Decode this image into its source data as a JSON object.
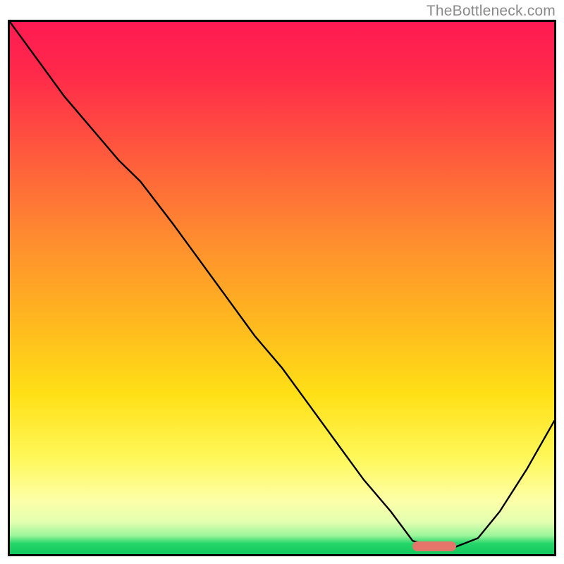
{
  "watermark": "TheBottleneck.com",
  "colors": {
    "gradient_top": "#ff1a52",
    "gradient_bottom": "#12c85e",
    "curve": "#000000",
    "marker": "#e5746b",
    "border": "#000000",
    "watermark": "#8a8a8a"
  },
  "chart_data": {
    "type": "line",
    "title": "",
    "xlabel": "",
    "ylabel": "",
    "xlim": [
      0,
      100
    ],
    "ylim": [
      0,
      100
    ],
    "grid": false,
    "legend": false,
    "background": "vertical red→yellow→green gradient (green at bottom)",
    "series": [
      {
        "name": "curve",
        "color": "#000000",
        "comment": "y is a distance/mismatch metric; 0 at bottom, 100 at top. Values estimated from pixel positions.",
        "x": [
          0,
          5,
          10,
          15,
          20,
          24,
          30,
          35,
          40,
          45,
          50,
          55,
          60,
          65,
          70,
          74,
          78,
          82,
          86,
          90,
          95,
          100
        ],
        "y": [
          100,
          93,
          86,
          80,
          74,
          70,
          62,
          55,
          48,
          41,
          35,
          28,
          21,
          14,
          8,
          2.5,
          1.4,
          1.4,
          3,
          8,
          16,
          25
        ]
      }
    ],
    "annotations": [
      {
        "name": "marker",
        "shape": "rounded-bar",
        "color": "#e5746b",
        "x_range": [
          74,
          82
        ],
        "y": 1.4
      }
    ]
  }
}
